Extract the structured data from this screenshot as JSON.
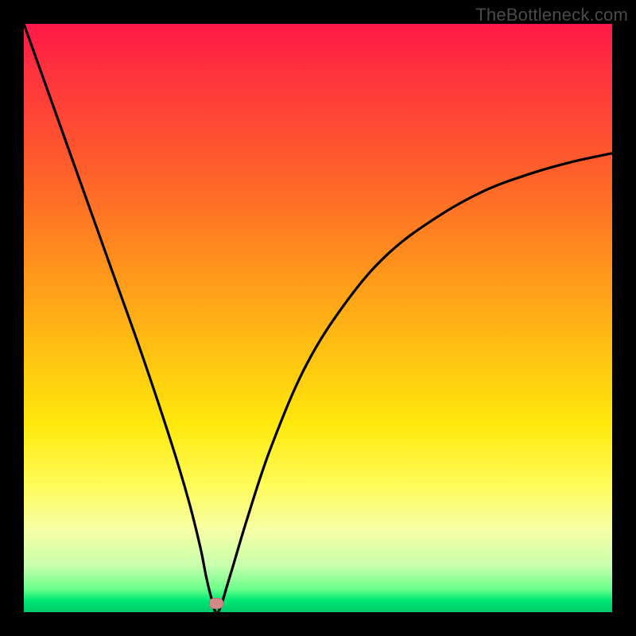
{
  "watermark": "TheBottleneck.com",
  "chart_data": {
    "type": "line",
    "title": "",
    "xlabel": "",
    "ylabel": "",
    "xlim": [
      0,
      100
    ],
    "ylim": [
      0,
      100
    ],
    "grid": false,
    "series": [
      {
        "name": "curve",
        "x": [
          0,
          5,
          10,
          15,
          20,
          25,
          28,
          30,
          31,
          32,
          33,
          35,
          38,
          42,
          48,
          55,
          62,
          70,
          78,
          86,
          93,
          100
        ],
        "values": [
          100,
          86,
          72,
          58,
          44,
          29,
          19,
          11,
          6,
          2,
          0,
          6,
          16,
          28,
          42,
          53,
          61,
          67,
          71.5,
          74.5,
          76.5,
          78
        ]
      }
    ],
    "marker": {
      "x": 32.7,
      "y": 1.5
    },
    "background_gradient": {
      "top": "#ff1748",
      "mid_upper": "#ff8f1d",
      "mid": "#ffe80c",
      "mid_lower": "#c9ffad",
      "bottom": "#00c969"
    },
    "curve_color": "#000000",
    "marker_color": "#cf8a88"
  }
}
